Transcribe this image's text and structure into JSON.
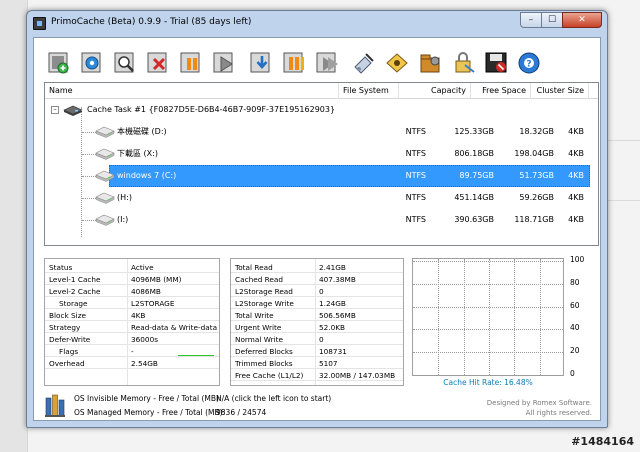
{
  "window": {
    "title": "PrimoCache (Beta) 0.9.9 - Trial (85 days left)",
    "controls": [
      "–",
      "☐",
      "✕"
    ]
  },
  "toolbar": {
    "buttons": [
      {
        "icon": "new-task-icon"
      },
      {
        "icon": "settings-gear-icon"
      },
      {
        "icon": "search-icon"
      },
      {
        "icon": "delete-task-icon"
      },
      {
        "icon": "pause-icon"
      },
      {
        "icon": "play-icon"
      },
      {
        "icon": "download-arrow-icon"
      },
      {
        "icon": "pause-all-icon"
      },
      {
        "icon": "resume-all-icon"
      },
      {
        "icon": "tools-icon"
      },
      {
        "icon": "license-key-icon"
      },
      {
        "icon": "preferences-icon"
      },
      {
        "icon": "lock-icon"
      },
      {
        "icon": "disk-save-icon"
      },
      {
        "icon": "help-icon"
      }
    ]
  },
  "list": {
    "headers": [
      "Name",
      "File System",
      "Capacity",
      "Free Space",
      "Cluster Size"
    ],
    "task": "Cache Task #1 {F0827D5E-D6B4-46B7-909F-37E195162903}",
    "task_expander": "–",
    "drives": [
      {
        "name": "本機磁碟 (D:)",
        "fs": "NTFS",
        "capacity": "125.33GB",
        "free": "18.32GB",
        "cluster": "4KB",
        "selected": false
      },
      {
        "name": "下載區 (X:)",
        "fs": "NTFS",
        "capacity": "806.18GB",
        "free": "198.04GB",
        "cluster": "4KB",
        "selected": false
      },
      {
        "name": "windows 7 (C:)",
        "fs": "NTFS",
        "capacity": "89.75GB",
        "free": "51.73GB",
        "cluster": "4KB",
        "selected": true
      },
      {
        "name": "(H:)",
        "fs": "NTFS",
        "capacity": "451.14GB",
        "free": "59.26GB",
        "cluster": "4KB",
        "selected": false
      },
      {
        "name": "(I:)",
        "fs": "NTFS",
        "capacity": "390.63GB",
        "free": "118.71GB",
        "cluster": "4KB",
        "selected": false
      }
    ]
  },
  "status_panel": [
    {
      "k": "Status",
      "v": "Active",
      "indent": false
    },
    {
      "k": "Level-1 Cache",
      "v": "4096MB (MM)",
      "indent": false
    },
    {
      "k": "Level-2 Cache",
      "v": "4086MB",
      "indent": false
    },
    {
      "k": "Storage",
      "v": "L2STORAGE",
      "indent": true
    },
    {
      "k": "Block Size",
      "v": "4KB",
      "indent": false
    },
    {
      "k": "Strategy",
      "v": "Read-data & Write-data",
      "indent": false
    },
    {
      "k": "Defer-Write",
      "v": "36000s",
      "indent": false
    },
    {
      "k": "Flags",
      "v": "-",
      "indent": true
    },
    {
      "k": "Overhead",
      "v": "2.54GB",
      "indent": false
    }
  ],
  "stats_panel": [
    {
      "k": "Total Read",
      "v": "2.41GB"
    },
    {
      "k": "Cached Read",
      "v": "407.38MB"
    },
    {
      "k": "L2Storage Read",
      "v": "0"
    },
    {
      "k": "L2Storage Write",
      "v": "1.24GB"
    },
    {
      "k": "Total Write",
      "v": "506.56MB"
    },
    {
      "k": "Urgent Write",
      "v": "52.0KB"
    },
    {
      "k": "Normal Write",
      "v": "0"
    },
    {
      "k": "Deferred Blocks",
      "v": "108731"
    },
    {
      "k": "Trimmed Blocks",
      "v": "5107"
    },
    {
      "k": "Free Cache (L1/L2)",
      "v": "32.00MB / 147.03MB"
    }
  ],
  "graph": {
    "y_ticks": [
      "100",
      "80",
      "60",
      "40",
      "20",
      "0"
    ],
    "hit_rate_label": "Cache Hit Rate: 16.48%",
    "current_hit_rate": 16.48,
    "line_color": "#2ec42e"
  },
  "footer": {
    "invisible_label": "OS Invisible Memory - Free / Total (MB):",
    "invisible_value": "N/A (click the left icon to start)",
    "managed_label": "OS Managed Memory - Free / Total (MB):",
    "managed_value": "9836 / 24574",
    "credit_1": "Designed by Romex Software.",
    "credit_2": "All rights reserved."
  },
  "background": {
    "watermark": "#1484164"
  },
  "colors": {
    "selection": "#3399ff",
    "window_frame": "#bfd4ec",
    "hit_rate_text": "#0a7fb8"
  }
}
